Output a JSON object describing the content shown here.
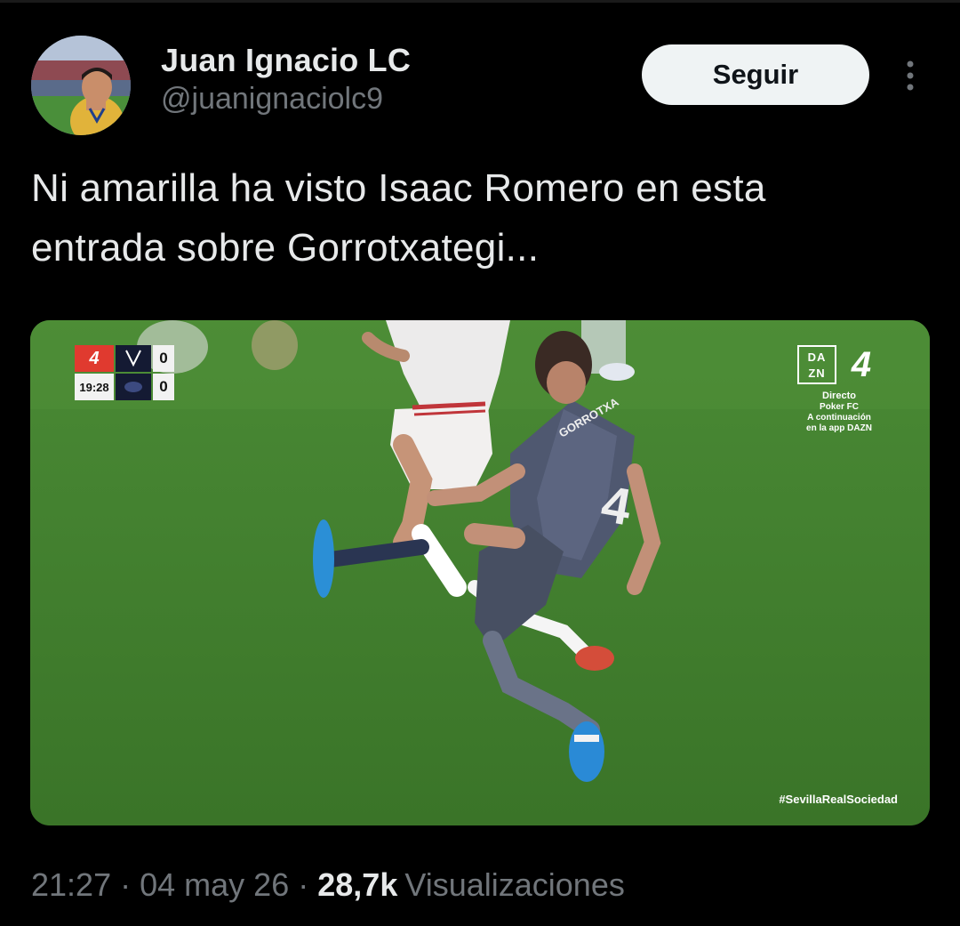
{
  "author": {
    "display_name": "Juan Ignacio LC",
    "handle": "@juanignaciolc9",
    "avatar_icon": "profile-photo"
  },
  "actions": {
    "follow_label": "Seguir",
    "more_icon": "more-options-icon"
  },
  "tweet": {
    "line_1": "Ni amarilla ha visto Isaac Romero en esta",
    "line_2": "entrada sobre Gorrotxategi..."
  },
  "media": {
    "scoreboard": {
      "league_mark": "4",
      "clock": "19:28",
      "home_score": "0",
      "away_score": "0"
    },
    "broadcaster": {
      "logo_top": "DA",
      "logo_bottom": "ZN",
      "league_mark": "4",
      "directo": "Directo",
      "program": "Poker FC",
      "continuation": "A continuación",
      "app_note": "en la app DAZN"
    },
    "shirt_number": "4",
    "shirt_name": "GORROTXA",
    "hashtag": "#SevillaRealSociedad"
  },
  "meta": {
    "time": "21:27",
    "sep_1": "·",
    "date": "04 may 26",
    "sep_2": "·",
    "views_count": "28,7k",
    "views_label": "Visualizaciones"
  },
  "colors": {
    "background": "#000000",
    "text_primary": "#e7e9ea",
    "text_secondary": "#71767b",
    "follow_bg": "#eff3f4",
    "pitch_green": "#3f7a2c"
  }
}
